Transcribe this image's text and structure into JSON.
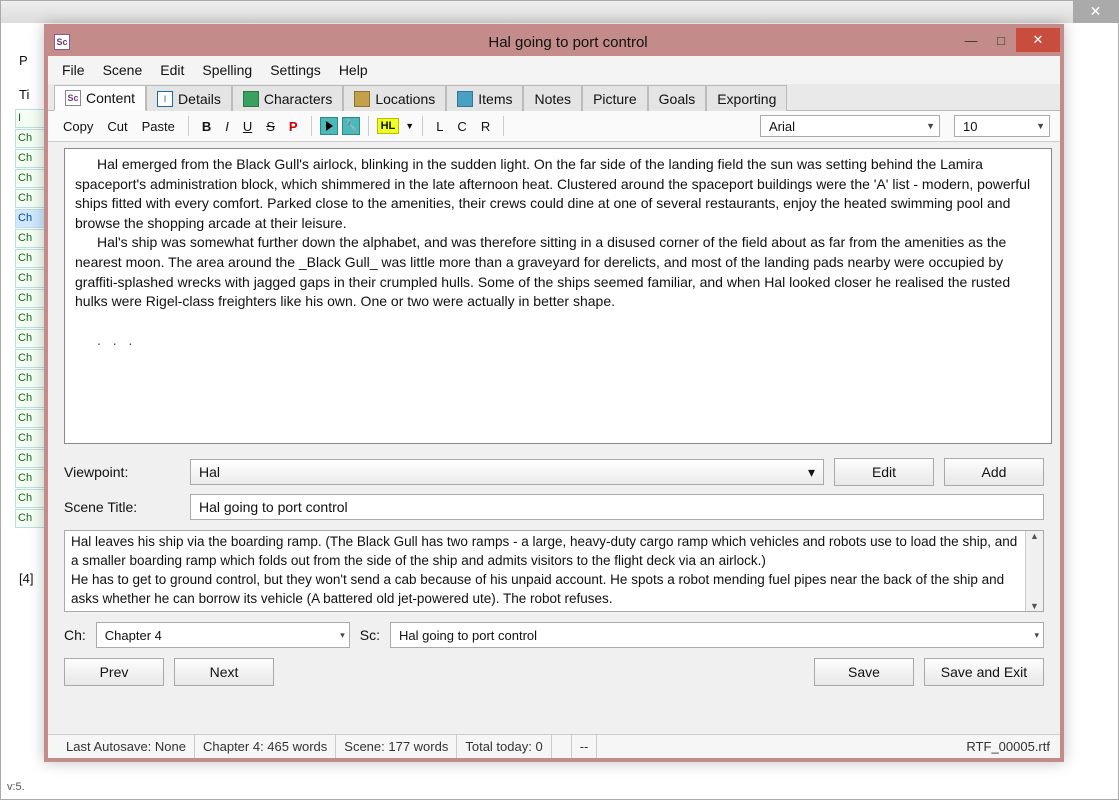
{
  "window": {
    "title": "Hal going to port control",
    "app_icon_text": "Sc"
  },
  "menubar": [
    "File",
    "Scene",
    "Edit",
    "Spelling",
    "Settings",
    "Help"
  ],
  "tabs": [
    {
      "icon": "sc",
      "icon_text": "Sc",
      "label": "Content",
      "active": true
    },
    {
      "icon": "de",
      "icon_text": "I",
      "label": "Details"
    },
    {
      "icon": "ch",
      "icon_text": "",
      "label": "Characters"
    },
    {
      "icon": "lo",
      "icon_text": "",
      "label": "Locations"
    },
    {
      "icon": "it",
      "icon_text": "",
      "label": "Items"
    },
    {
      "icon": "",
      "icon_text": "",
      "label": "Notes"
    },
    {
      "icon": "",
      "icon_text": "",
      "label": "Picture"
    },
    {
      "icon": "",
      "icon_text": "",
      "label": "Goals"
    },
    {
      "icon": "",
      "icon_text": "",
      "label": "Exporting"
    }
  ],
  "fmt": {
    "copy": "Copy",
    "cut": "Cut",
    "paste": "Paste",
    "b": "B",
    "i": "I",
    "u": "U",
    "s": "S",
    "p": "P",
    "hl": "HL",
    "l": "L",
    "c": "C",
    "r": "R",
    "font": "Arial",
    "size": "10"
  },
  "editor": {
    "p1": "Hal emerged from the Black Gull's airlock, blinking in the sudden light. On the far side of the landing field the sun was setting behind the Lamira spaceport's administration block, which shimmered in the late afternoon heat. Clustered around the spaceport buildings were the 'A' list - modern, powerful ships fitted with every comfort. Parked close to the amenities, their crews could dine at one of several restaurants, enjoy the heated swimming pool and browse the shopping arcade at their leisure.",
    "p2": "Hal's ship was somewhat further down the alphabet, and was therefore sitting in a disused corner of the field about as far from the amenities as the nearest moon. The area around the _Black Gull_ was little more than a graveyard for derelicts, and most of the landing pads nearby were occupied by graffiti-splashed wrecks with jagged gaps in their crumpled hulls. Some of the ships seemed familiar, and when Hal looked closer he realised the rusted hulks were Rigel-class freighters like his own. One or two were actually in better shape.",
    "dots": ". . ."
  },
  "viewpoint": {
    "label": "Viewpoint:",
    "value": "Hal",
    "edit": "Edit",
    "add": "Add"
  },
  "scene_title": {
    "label": "Scene Title:",
    "value": "Hal going to port control"
  },
  "notes": {
    "l1": "Hal leaves his ship via the boarding ramp. (The Black Gull has two ramps - a large, heavy-duty cargo ramp which vehicles and robots use to load the ship, and a smaller boarding ramp which folds out from the side of the ship and admits visitors to the flight deck via an airlock.)",
    "l2": "He has to get to ground control, but they won't send a cab because of his unpaid account. He spots a robot mending fuel pipes near the back of the ship and asks whether he can borrow its vehicle (A battered old jet-powered ute). The robot refuses."
  },
  "chsc": {
    "ch_label": "Ch:",
    "ch_value": "Chapter 4",
    "sc_label": "Sc:",
    "sc_value": "Hal going to port control"
  },
  "footer_buttons": {
    "prev": "Prev",
    "next": "Next",
    "save": "Save",
    "save_exit": "Save and Exit"
  },
  "status": {
    "autosave": "Last Autosave: None",
    "chapter_words": "Chapter 4: 465 words",
    "scene_words": "Scene: 177 words",
    "total_today": "Total today: 0",
    "dash": "--",
    "filename": "RTF_00005.rtf"
  },
  "back": {
    "labels": [
      "I",
      "Ch",
      "Ch",
      "Ch",
      "Ch",
      "Ch",
      "Ch",
      "Ch",
      "Ch",
      "Ch",
      "Ch",
      "Ch",
      "Ch",
      "Ch",
      "Ch",
      "Ch",
      "Ch",
      "Ch",
      "Ch",
      "Ch",
      "Ch"
    ],
    "version": "v:5.",
    "four": "[4]",
    "ti": "Ti",
    "p": "P"
  }
}
